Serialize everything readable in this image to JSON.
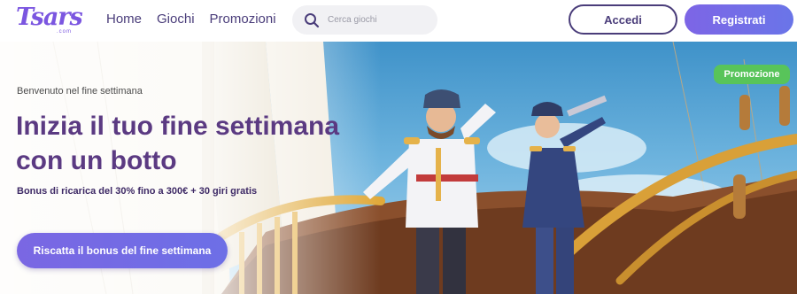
{
  "header": {
    "logo_text": "Tsars",
    "logo_sub": ".com",
    "nav": [
      {
        "label": "Home"
      },
      {
        "label": "Giochi"
      },
      {
        "label": "Promozioni"
      }
    ],
    "search": {
      "placeholder": "Cerca giochi",
      "value": ""
    },
    "login_label": "Accedi",
    "register_label": "Registrati"
  },
  "hero": {
    "eyebrow": "Benvenuto nel fine settimana",
    "headline": "Inizia il tuo fine settimana con un botto",
    "subline": "Bonus di ricarica del 30% fino a 300€ + 30 giri gratis",
    "cta_label": "Riscatta il bonus del fine settimana",
    "badge_label": "Promozione"
  },
  "colors": {
    "brand": "#7b56e0",
    "heading": "#5b3a82",
    "primary_button": "#7a67e3",
    "badge": "#58c45a"
  },
  "icons": {
    "search": "search-icon",
    "logo": "tsars-logo"
  }
}
